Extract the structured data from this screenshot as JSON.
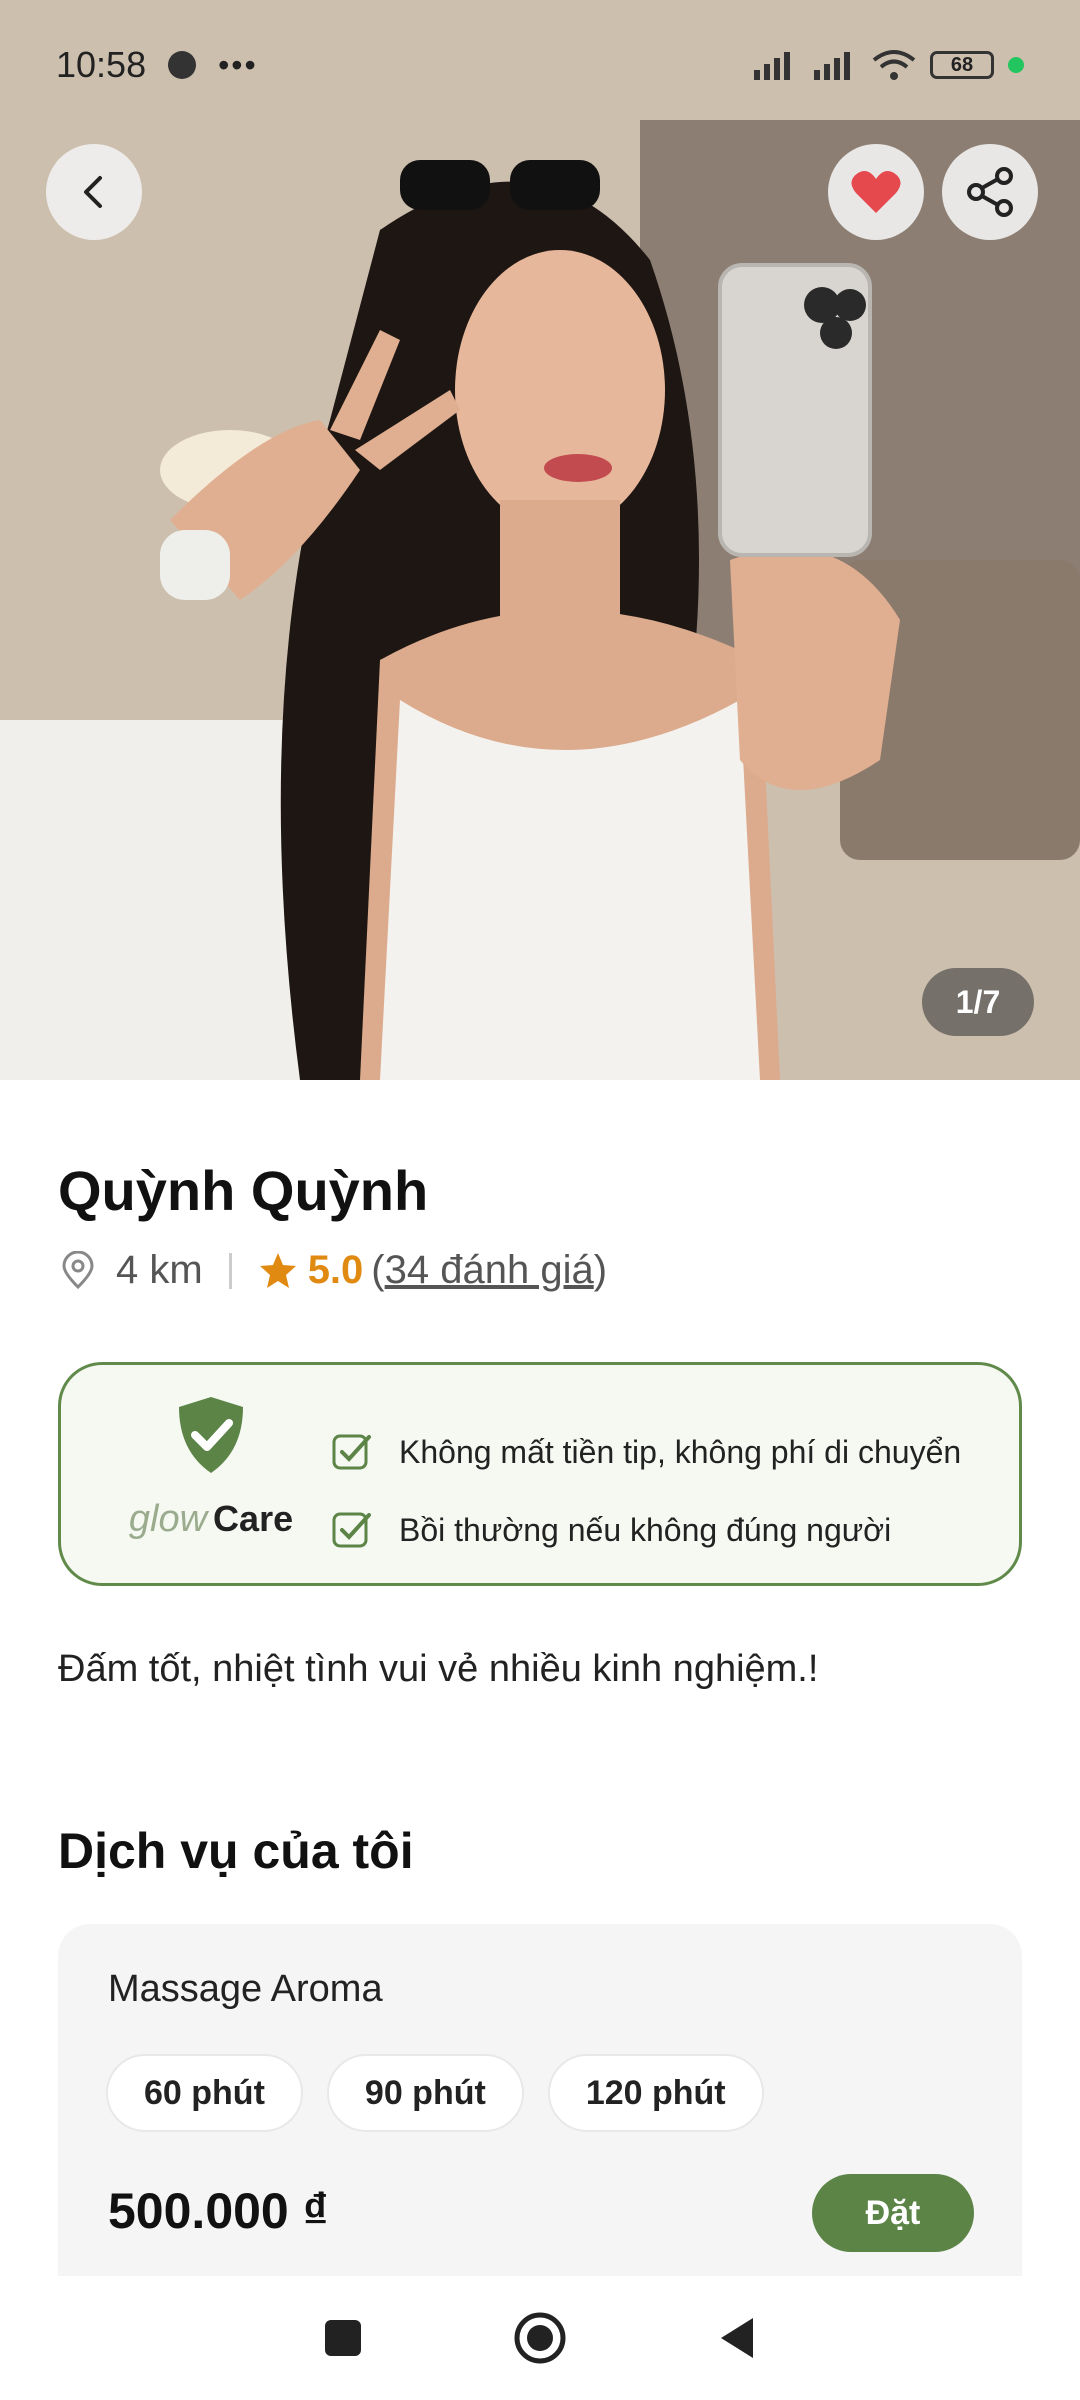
{
  "status_bar": {
    "time": "10:58",
    "more": "•••",
    "battery": "68"
  },
  "gallery": {
    "counter": "1/7"
  },
  "profile": {
    "name": "Quỳnh Quỳnh",
    "distance": "4 km",
    "rating": "5.0",
    "reviews_open": "(",
    "reviews_text": "34 đánh giá",
    "reviews_close": ")",
    "description": "Đấm tốt, nhiệt tình vui vẻ nhiều kinh nghiệm.!"
  },
  "care": {
    "brand_glow": "glow",
    "brand_care": "Care",
    "items": [
      "Không mất tiền tip, không phí di chuyển",
      "Bồi thường nếu không đúng người"
    ]
  },
  "services": {
    "title": "Dịch vụ của tôi",
    "items": [
      {
        "name": "Massage Aroma",
        "durations": [
          "60 phút",
          "90 phút",
          "120 phút"
        ],
        "price": "500.000 ₫",
        "book_label": "Đặt"
      }
    ]
  },
  "colors": {
    "accent": "#5c8447",
    "rating": "#e08a12",
    "heart": "#e5484d"
  },
  "icons": [
    "back-icon",
    "heart-icon",
    "share-icon",
    "location-icon",
    "star-icon",
    "shield-check-icon",
    "checkbox-icon"
  ]
}
